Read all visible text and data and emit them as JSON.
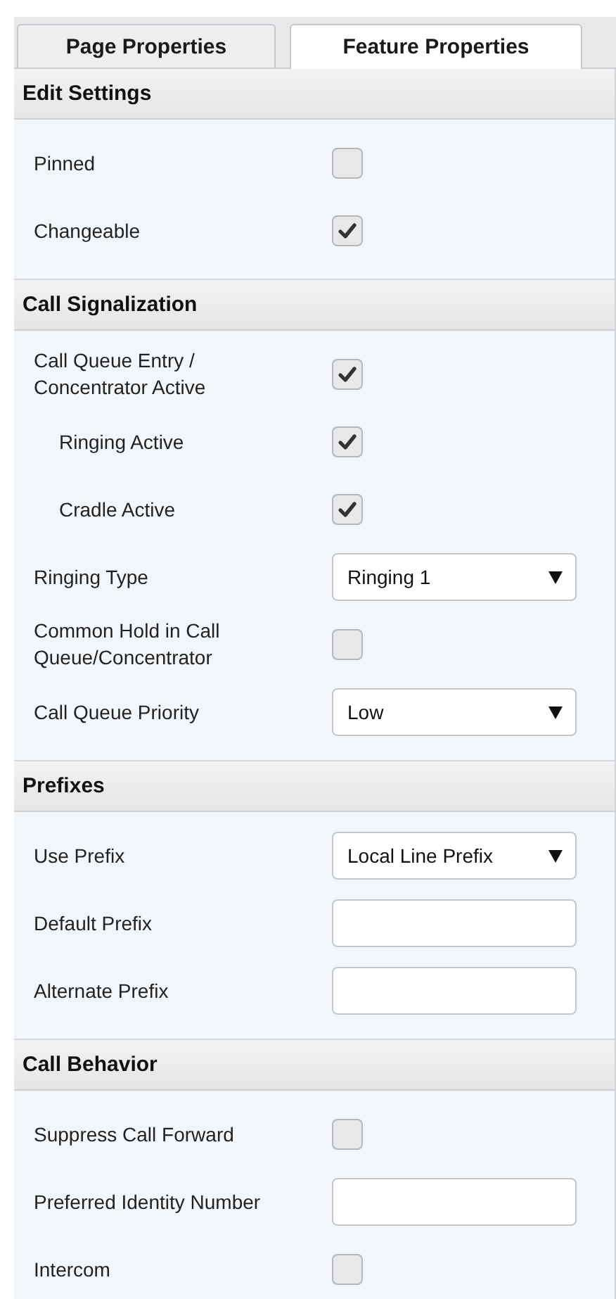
{
  "tabs": [
    {
      "label": "Page Properties",
      "selected": false
    },
    {
      "label": "Feature Properties",
      "selected": true
    }
  ],
  "sections": [
    {
      "title": "Edit Settings",
      "rows": [
        {
          "kind": "checkbox",
          "label": "Pinned",
          "checked": false
        },
        {
          "kind": "checkbox",
          "label": "Changeable",
          "checked": true
        }
      ]
    },
    {
      "title": "Call Signalization",
      "rows": [
        {
          "kind": "checkbox",
          "label": "Call Queue Entry / Concentrator Active",
          "checked": true,
          "children": [
            {
              "kind": "checkbox",
              "label": "Ringing Active",
              "checked": true
            },
            {
              "kind": "checkbox",
              "label": "Cradle Active",
              "checked": true
            }
          ]
        },
        {
          "kind": "select",
          "label": "Ringing Type",
          "value": "Ringing 1"
        },
        {
          "kind": "checkbox",
          "label": "Common Hold in Call Queue/Concentrator",
          "checked": false
        },
        {
          "kind": "select",
          "label": "Call Queue Priority",
          "value": "Low"
        }
      ]
    },
    {
      "title": "Prefixes",
      "rows": [
        {
          "kind": "select",
          "label": "Use Prefix",
          "value": "Local Line Prefix"
        },
        {
          "kind": "text",
          "label": "Default Prefix"
        },
        {
          "kind": "text",
          "label": "Alternate Prefix"
        }
      ]
    },
    {
      "title": "Call Behavior",
      "rows": [
        {
          "kind": "checkbox",
          "label": "Suppress Call Forward",
          "checked": false
        },
        {
          "kind": "text",
          "label": "Preferred Identity Number"
        },
        {
          "kind": "checkbox",
          "label": "Intercom",
          "checked": false
        }
      ]
    }
  ]
}
